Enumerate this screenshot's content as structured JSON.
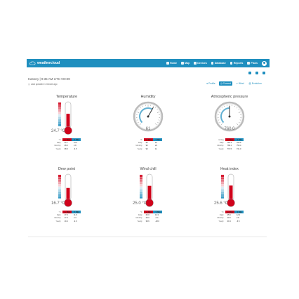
{
  "header": {
    "logo_text": "weathercloud",
    "nav": [
      {
        "label": "Home",
        "icon": "home-icon"
      },
      {
        "label": "Map",
        "icon": "globe-icon"
      },
      {
        "label": "Devices",
        "icon": "devices-icon"
      },
      {
        "label": "Database",
        "icon": "database-icon"
      },
      {
        "label": "Reports",
        "icon": "reports-icon"
      },
      {
        "label": "Plans",
        "icon": "plans-icon"
      }
    ]
  },
  "station": {
    "title": "Kastory | 9:35 AM UTC+00:00",
    "updated": "Last updated 1 minute ago"
  },
  "tabs": [
    {
      "label": "Profile",
      "icon": "profile-icon"
    },
    {
      "label": "Current",
      "icon": "current-icon"
    },
    {
      "label": "Wind",
      "icon": "wind-icon"
    },
    {
      "label": "Evolution",
      "icon": "evolution-icon"
    }
  ],
  "panels": [
    {
      "title": "Temperature",
      "reading": "24.7 °C",
      "kind": "thermo",
      "fill": 0.55,
      "table": {
        "headers": [
          "°C",
          "▲ Max",
          "▼ Min"
        ],
        "rows": [
          [
            "Daily",
            "24.7",
            "12.3"
          ],
          [
            "Monthly",
            "28.0",
            "2.8"
          ],
          [
            "Yearly",
            "38.5",
            "-6.5"
          ]
        ]
      }
    },
    {
      "title": "Humidity",
      "reading": "61",
      "kind": "gauge",
      "gauge_value": 0.61,
      "table": {
        "headers": [
          "%",
          "▲ Max",
          "▼ Min"
        ],
        "rows": [
          [
            "Daily",
            "99",
            "61"
          ],
          [
            "Monthly",
            "99",
            "24"
          ],
          [
            "Yearly",
            "99",
            "11"
          ]
        ]
      }
    },
    {
      "title": "Atmospheric pressure",
      "reading": "760.0",
      "kind": "gauge",
      "gauge_value": 0.5,
      "table": {
        "headers": [
          "mmHg",
          "▲ Max",
          "▼ Min"
        ],
        "rows": [
          [
            "Daily",
            "760.3",
            "759.5"
          ],
          [
            "Monthly",
            "768.1",
            "750.4"
          ],
          [
            "Yearly",
            "774.5",
            "741.0"
          ]
        ]
      }
    },
    {
      "title": "Dew point",
      "reading": "16.7 °C",
      "kind": "thermo",
      "fill": 0.48,
      "table": {
        "headers": [
          "°C",
          "▲ Max",
          "▼ Min"
        ],
        "rows": [
          [
            "Daily",
            "17.0",
            "11.9"
          ],
          [
            "Monthly",
            "17.5",
            "2.4"
          ],
          [
            "Yearly",
            "19.4",
            "-9.0"
          ]
        ]
      }
    },
    {
      "title": "Wind chill",
      "reading": "25.0 °C",
      "kind": "thermo",
      "fill": 0.56,
      "table": {
        "headers": [
          "°C",
          "▲ Max",
          "▼ Min"
        ],
        "rows": [
          [
            "Daily",
            "25.0",
            "12.3"
          ],
          [
            "Monthly",
            "28.0",
            "-0.4"
          ],
          [
            "Yearly",
            "38.6",
            "-18.0"
          ]
        ]
      }
    },
    {
      "title": "Heat index",
      "reading": "25.6 °C",
      "kind": "thermo",
      "fill": 0.57,
      "table": {
        "headers": [
          "°C",
          "▲ Max",
          "▼ Min"
        ],
        "rows": [
          [
            "Daily",
            "25.6",
            "12.3"
          ],
          [
            "Monthly",
            "29.6",
            "2.8"
          ],
          [
            "Yearly",
            "40.4",
            "-6.5"
          ]
        ]
      }
    }
  ],
  "colors": {
    "brand": "#1f8fbf",
    "max": "#d0021b",
    "min": "#1f8fbf"
  }
}
